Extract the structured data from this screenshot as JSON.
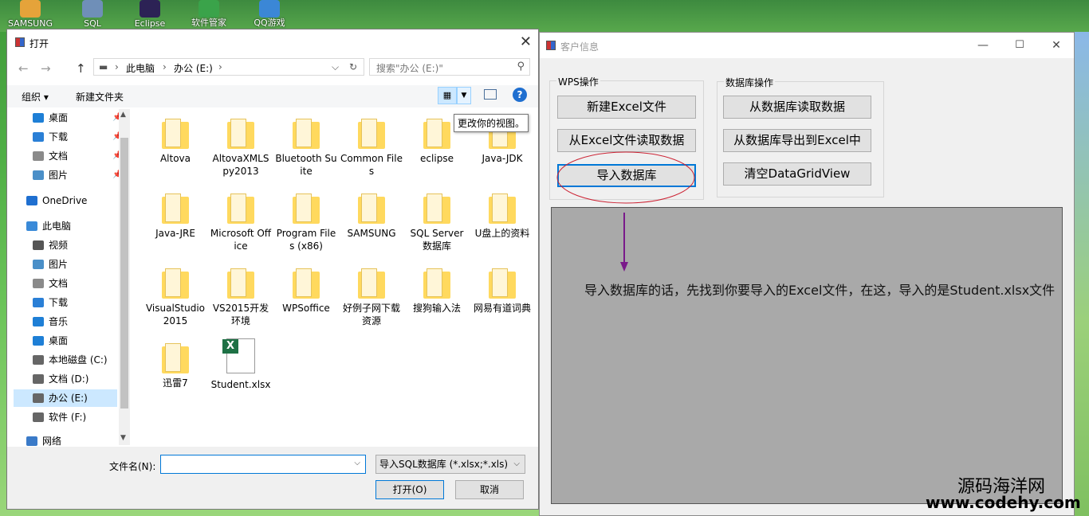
{
  "desktop": {
    "icons": [
      {
        "label": "SAMSUNG",
        "color": "#e5a33a"
      },
      {
        "label": "SQL",
        "color": "#6f8fb8"
      },
      {
        "label": "Eclipse",
        "color": "#2c2255"
      },
      {
        "label": "软件管家",
        "color": "#3aa34a"
      },
      {
        "label": "QQ游戏",
        "color": "#3b87d6"
      }
    ]
  },
  "customer_window": {
    "title": "客户信息",
    "controls": {
      "minimize": "—",
      "maximize": "☐",
      "close": "✕"
    },
    "wps_group": {
      "title": "WPS操作",
      "buttons": [
        "新建Excel文件",
        "从Excel文件读取数据",
        "导入数据库"
      ]
    },
    "db_group": {
      "title": "数据库操作",
      "buttons": [
        "从数据库读取数据",
        "从数据库导出到Excel中",
        "清空DataGridView"
      ]
    },
    "note": "导入数据库的话，先找到你要导入的Excel文件，在这，导入的是Student.xlsx文件",
    "watermark_line1": "源码海洋网",
    "watermark_line2": "www.codehy.com",
    "annotation_color": "#cc2233",
    "arrow_color": "#7a1a8a"
  },
  "open_dialog": {
    "title": "打开",
    "close": "✕",
    "nav": {
      "back": "←",
      "forward": "→",
      "up": "↑"
    },
    "address": {
      "crumbs": [
        "此电脑",
        "办公 (E:)"
      ]
    },
    "search": {
      "placeholder": "搜索\"办公 (E:)\""
    },
    "toolbar": {
      "organize": "组织 ▾",
      "new_folder": "新建文件夹"
    },
    "tooltip": "更改你的视图。",
    "nav_items": [
      {
        "label": "桌面",
        "pinned": true,
        "color": "#1e7fd6"
      },
      {
        "label": "下载",
        "pinned": true,
        "color": "#2a7fd6"
      },
      {
        "label": "文档",
        "pinned": true,
        "color": "#8a8a8a"
      },
      {
        "label": "图片",
        "pinned": true,
        "color": "#4a8fc8"
      },
      {
        "label": "OneDrive",
        "pinned": false,
        "color": "#1f6fd0"
      },
      {
        "label": "此电脑",
        "pinned": false,
        "color": "#3a8ad8"
      },
      {
        "label": "视频",
        "pinned": false,
        "color": "#555555"
      },
      {
        "label": "图片",
        "pinned": false,
        "color": "#4a8fc8"
      },
      {
        "label": "文档",
        "pinned": false,
        "color": "#8a8a8a"
      },
      {
        "label": "下载",
        "pinned": false,
        "color": "#2a7fd6"
      },
      {
        "label": "音乐",
        "pinned": false,
        "color": "#1e7fd6"
      },
      {
        "label": "桌面",
        "pinned": false,
        "color": "#1e7fd6"
      },
      {
        "label": "本地磁盘 (C:)",
        "pinned": false,
        "color": "#666666"
      },
      {
        "label": "文档 (D:)",
        "pinned": false,
        "color": "#666666"
      },
      {
        "label": "办公 (E:)",
        "pinned": false,
        "color": "#666666"
      },
      {
        "label": "软件 (F:)",
        "pinned": false,
        "color": "#666666"
      },
      {
        "label": "网络",
        "pinned": false,
        "color": "#3a7ac8"
      }
    ],
    "files": [
      "Altova",
      "AltovaXMLSpy2013",
      "Bluetooth Suite",
      "Common Files",
      "eclipse",
      "Java-JDK",
      "Java-JRE",
      "Microsoft Office",
      "Program Files (x86)",
      "SAMSUNG",
      "SQL Server数据库",
      "U盘上的资料",
      "VisualStudio2015",
      "VS2015开发环境",
      "WPSoffice",
      "好例子网下载资源",
      "搜狗输入法",
      "网易有道词典",
      "迅雷7",
      "Student.xlsx"
    ],
    "filename_label": "文件名(N):",
    "filename_value": "",
    "filter": "导入SQL数据库 (*.xlsx;*.xls)",
    "open_button": "打开(O)",
    "cancel_button": "取消",
    "accent": "#0078d7"
  }
}
